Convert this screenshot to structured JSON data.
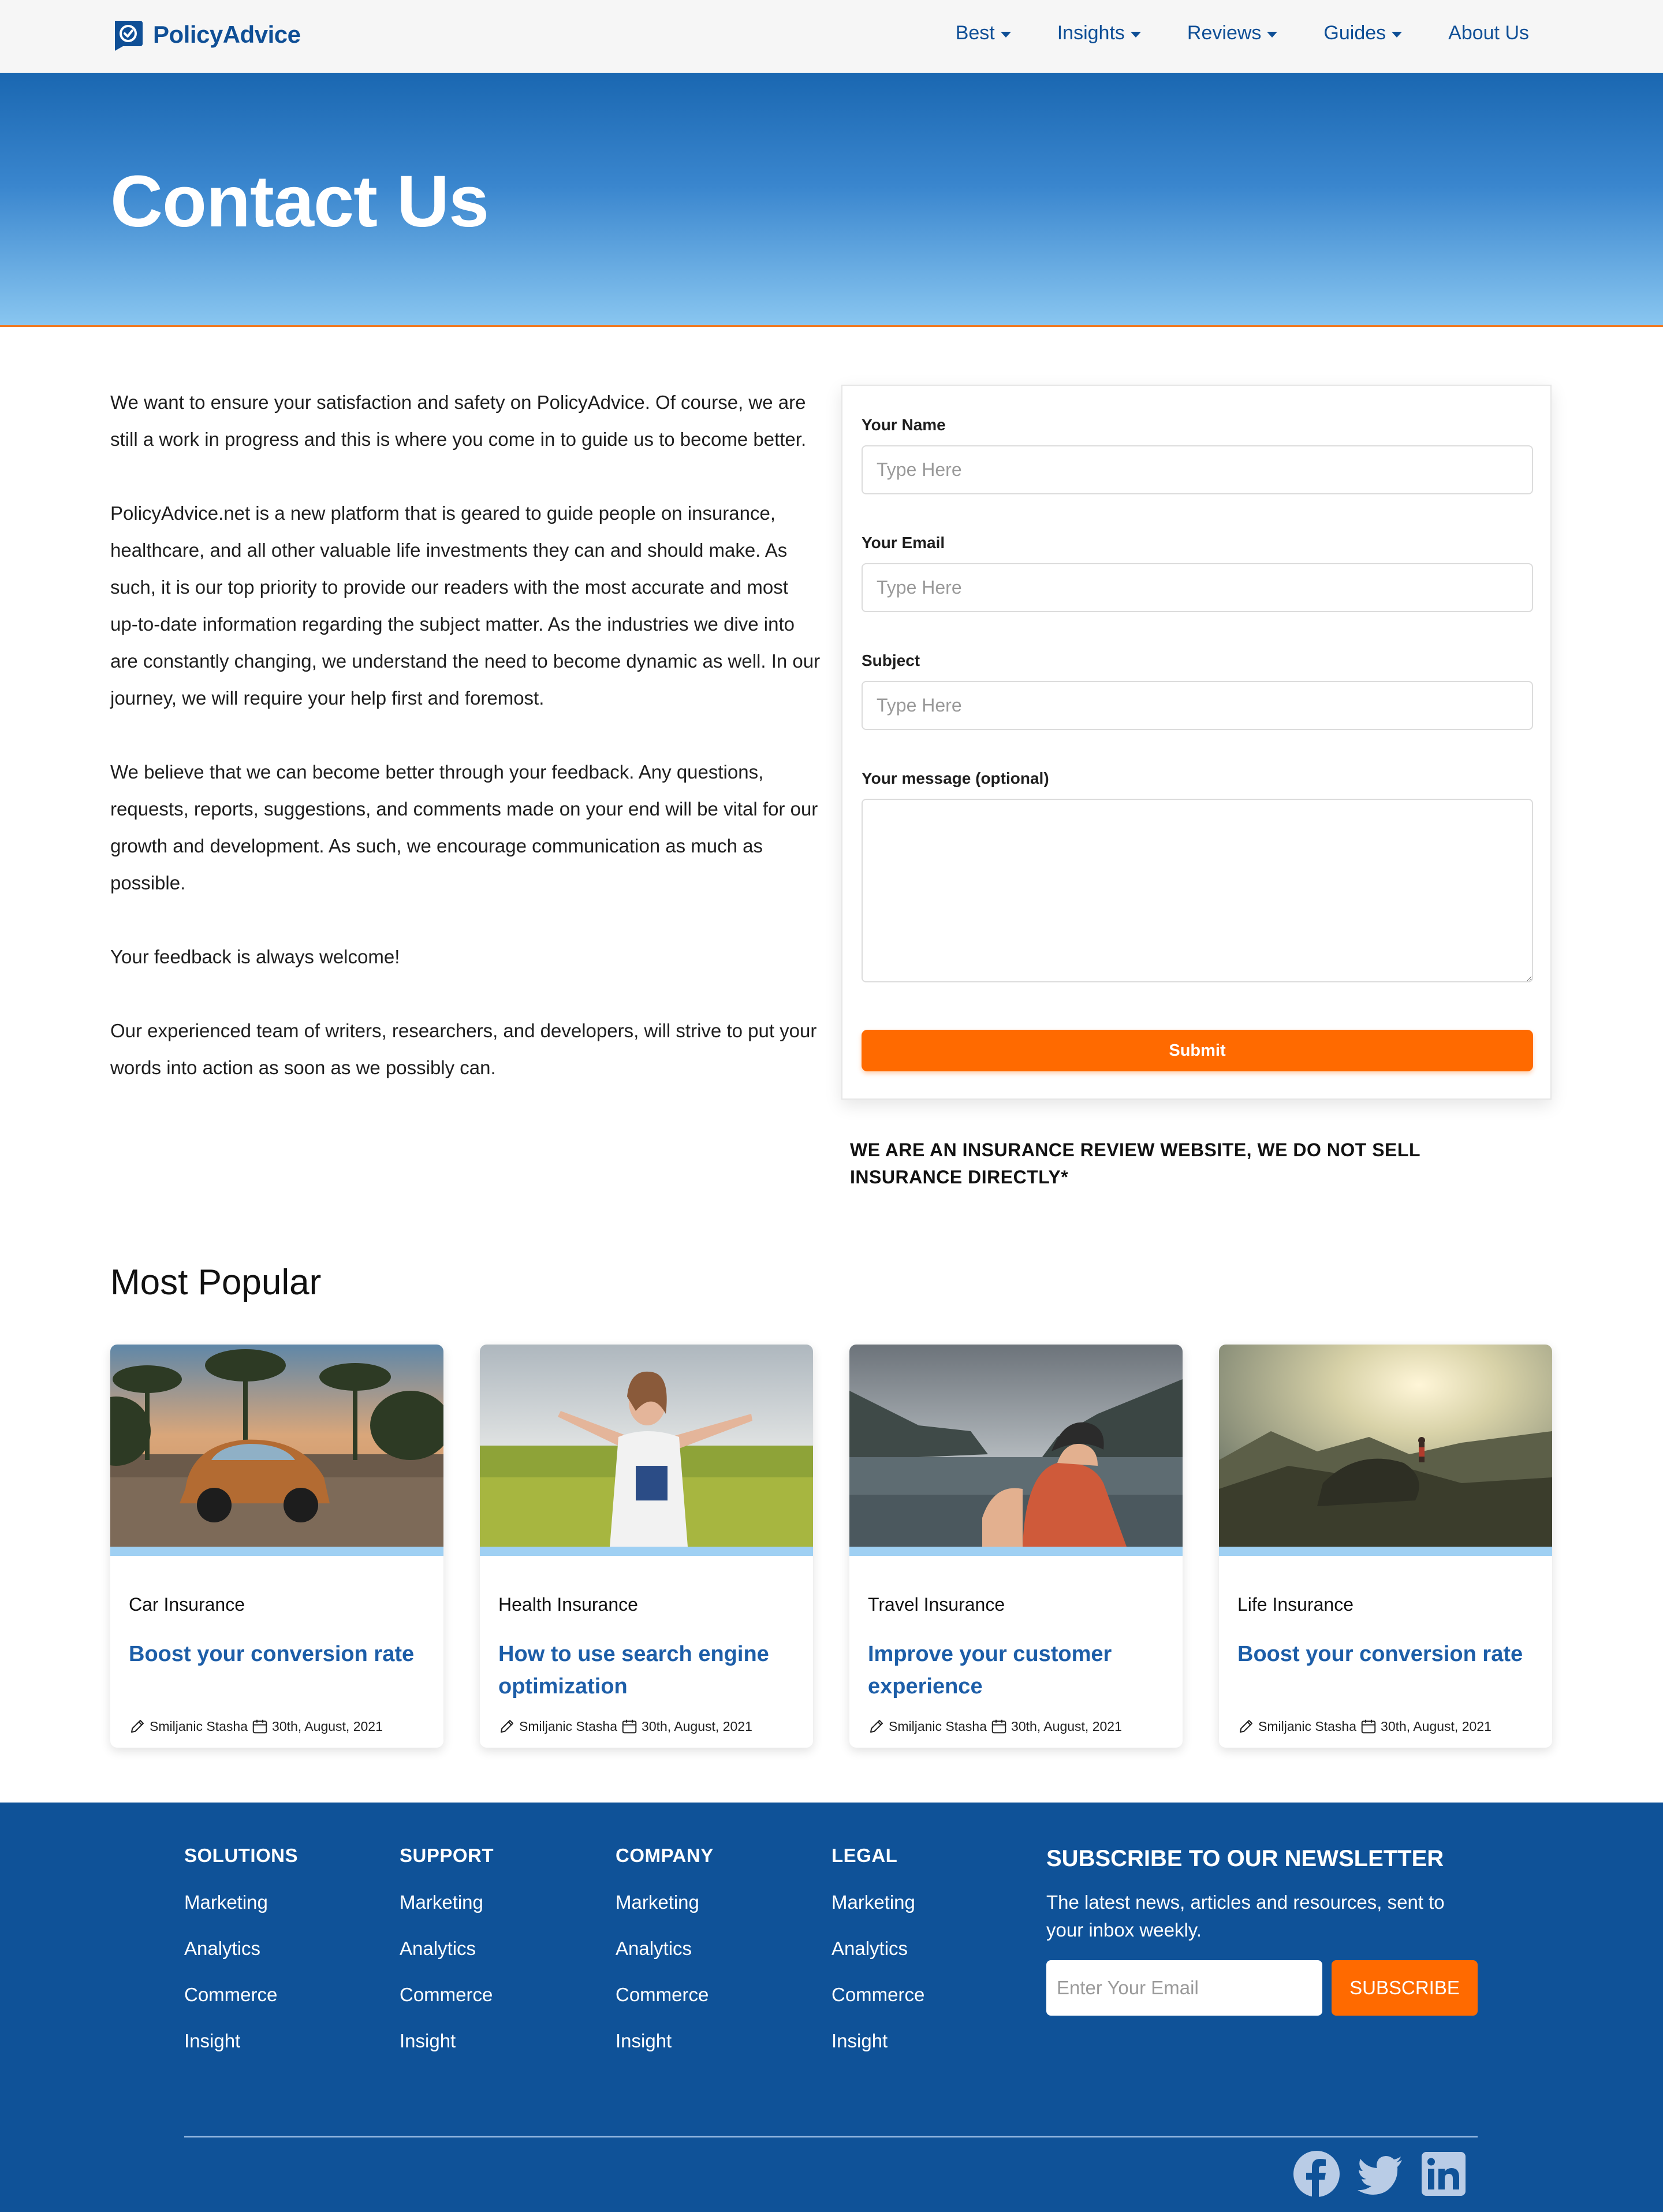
{
  "brand": {
    "name": "PolicyAdvice"
  },
  "nav": {
    "items": [
      {
        "label": "Best",
        "dropdown": true
      },
      {
        "label": "Insights",
        "dropdown": true
      },
      {
        "label": "Reviews",
        "dropdown": true
      },
      {
        "label": "Guides",
        "dropdown": true
      },
      {
        "label": "About Us",
        "dropdown": false
      }
    ]
  },
  "hero": {
    "title": "Contact Us"
  },
  "intro": {
    "paragraphs": [
      "We want to ensure your satisfaction and safety on PolicyAdvice. Of course, we are still a work in progress and this is where you come in to guide us to become better.",
      "PolicyAdvice.net is a new platform that is geared to guide people on insurance, healthcare, and all other valuable life investments they can and should make. As such, it is our top priority to provide our readers with the most accurate and most up-to-date information regarding the subject matter. As the industries we dive into are constantly changing, we understand the need to become dynamic as well. In our journey, we will require your help first and foremost.",
      "We believe that we can become better through your feedback. Any questions, requests, reports, suggestions, and comments made on your end will be vital for our growth and development. As such, we encourage communication as much as possible.",
      "Your feedback is always welcome!",
      "Our experienced team of writers, researchers, and developers, will strive to put your words into action as soon as we possibly can."
    ]
  },
  "form": {
    "name_label": "Your Name",
    "name_placeholder": "Type Here",
    "email_label": "Your Email",
    "email_placeholder": "Type Here",
    "subject_label": "Subject",
    "subject_placeholder": "Type Here",
    "message_label": "Your message (optional)",
    "submit_label": "Submit"
  },
  "disclaimer": "WE ARE AN INSURANCE REVIEW WEBSITE, WE DO NOT SELL INSURANCE DIRECTLY*",
  "most_popular": {
    "title": "Most Popular",
    "cards": [
      {
        "category": "Car Insurance",
        "title": "Boost your conversion rate",
        "author": "Smiljanic Stasha",
        "date": "30th, August, 2021"
      },
      {
        "category": "Health Insurance",
        "title": "How to use search engine optimization",
        "author": "Smiljanic Stasha",
        "date": "30th, August, 2021"
      },
      {
        "category": "Travel Insurance",
        "title": "Improve your customer experience",
        "author": "Smiljanic Stasha",
        "date": "30th, August, 2021"
      },
      {
        "category": "Life Insurance",
        "title": "Boost your conversion rate",
        "author": "Smiljanic Stasha",
        "date": "30th, August, 2021"
      }
    ]
  },
  "footer": {
    "columns": [
      {
        "heading": "SOLUTIONS",
        "links": [
          "Marketing",
          "Analytics",
          "Commerce",
          "Insight"
        ]
      },
      {
        "heading": "SUPPORT",
        "links": [
          "Marketing",
          "Analytics",
          "Commerce",
          "Insight"
        ]
      },
      {
        "heading": "COMPANY",
        "links": [
          "Marketing",
          "Analytics",
          "Commerce",
          "Insight"
        ]
      },
      {
        "heading": "LEGAL",
        "links": [
          "Marketing",
          "Analytics",
          "Commerce",
          "Insight"
        ]
      }
    ],
    "newsletter": {
      "heading": "SUBSCRIBE TO OUR NEWSLETTER",
      "description": "The latest news, articles and resources, sent to your inbox weekly.",
      "placeholder": "Enter Your Email",
      "button_label": "SUBSCRIBE"
    },
    "social": [
      "facebook-icon",
      "twitter-icon",
      "linkedin-icon"
    ]
  },
  "colors": {
    "brand_blue": "#0f4f96",
    "accent_orange": "#ff6a00",
    "footer_blue": "#0f5298",
    "link_blue": "#1d5ea8"
  }
}
